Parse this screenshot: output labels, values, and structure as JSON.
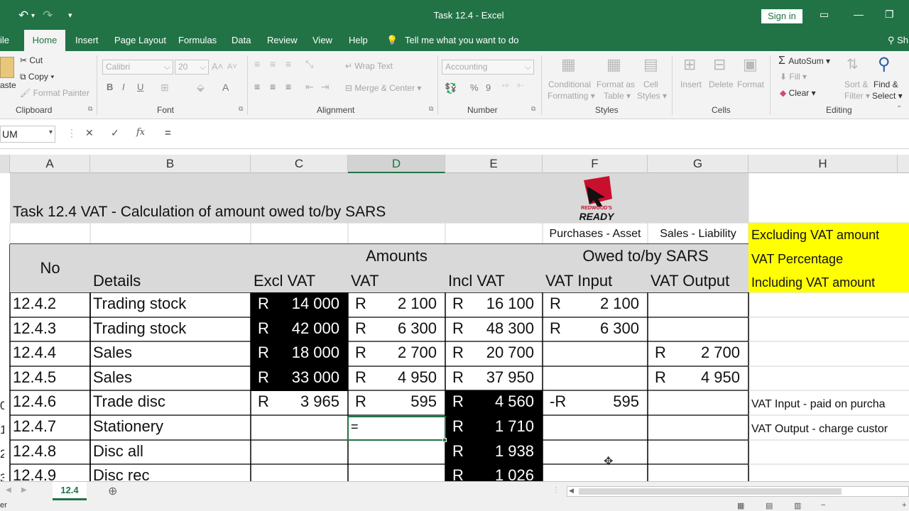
{
  "window": {
    "title": "Task 12.4 - Excel",
    "sign_in": "Sign in"
  },
  "tabs": [
    "ile",
    "Home",
    "Insert",
    "Page Layout",
    "Formulas",
    "Data",
    "Review",
    "View",
    "Help"
  ],
  "tell_me": "Tell me what you want to do",
  "share_partial": "Sh",
  "ribbon": {
    "clipboard": {
      "paste": "aste",
      "cut": "Cut",
      "copy": "Copy",
      "format_painter": "Format Painter",
      "group": "Clipboard"
    },
    "font": {
      "name": "Calibri",
      "size": "20",
      "bold": "B",
      "italic": "I",
      "underline": "U",
      "font_color": "A",
      "group": "Font"
    },
    "alignment": {
      "wrap_text": "Wrap Text",
      "merge": "Merge & Center",
      "group": "Alignment"
    },
    "number": {
      "format": "Accounting",
      "percent": "%",
      "comma": "9",
      "group": "Number"
    },
    "styles": {
      "conditional": "Conditional",
      "conditional2": "Formatting",
      "format_as": "Format as",
      "format_as2": "Table",
      "cell_styles": "Cell",
      "cell_styles2": "Styles",
      "group": "Styles"
    },
    "cells": {
      "insert": "Insert",
      "delete": "Delete",
      "format": "Format",
      "group": "Cells"
    },
    "editing": {
      "autosum": "AutoSum",
      "fill": "Fill",
      "clear": "Clear",
      "sort": "Sort &",
      "sort2": "Filter",
      "find": "Find &",
      "find2": "Select",
      "group": "Editing"
    }
  },
  "formula_bar": {
    "name_box": "UM",
    "cancel": "✕",
    "enter": "✓",
    "fx": "fx",
    "content": "="
  },
  "columns": [
    "A",
    "B",
    "C",
    "D",
    "E",
    "F",
    "G",
    "H"
  ],
  "logo": {
    "line1": "REDWOOD'S",
    "line2": "READY"
  },
  "sheet": {
    "title": "Task 12.4  VAT -  Calculation of amount owed to/by SARS",
    "purchases_label": "Purchases - Asset",
    "sales_label": "Sales - Liability",
    "no": "No",
    "details": "Details",
    "amounts": "Amounts",
    "owed": "Owed to/by SARS",
    "excl": "Excl VAT",
    "vat": "VAT",
    "incl": "Incl VAT",
    "vat_input": "VAT Input",
    "vat_output": "VAT Output",
    "legend": [
      "Excluding VAT amount",
      "VAT Percentage",
      "Including VAT amount"
    ],
    "rows": [
      {
        "no": "12.4.2",
        "details": "Trading stock",
        "c": "14 000",
        "d": "2 100",
        "e": "16 100",
        "f": "2 100",
        "g": ""
      },
      {
        "no": "12.4.3",
        "details": "Trading stock",
        "c": "42 000",
        "d": "6 300",
        "e": "48 300",
        "f": "6 300",
        "g": ""
      },
      {
        "no": "12.4.4",
        "details": "Sales",
        "c": "18 000",
        "d": "2 700",
        "e": "20 700",
        "f": "",
        "g": "2 700"
      },
      {
        "no": "12.4.5",
        "details": "Sales",
        "c": "33 000",
        "d": "4 950",
        "e": "37 950",
        "f": "",
        "g": "4 950"
      },
      {
        "no": "12.4.6",
        "details": "Trade disc",
        "c": "3 965",
        "d": "595",
        "e": "4 560",
        "f": "595",
        "g": ""
      },
      {
        "no": "12.4.7",
        "details": "Stationery",
        "c": "",
        "d": "=",
        "e": "1 710",
        "f": "",
        "g": ""
      },
      {
        "no": "12.4.8",
        "details": "Disc all",
        "c": "",
        "d": "",
        "e": "1 938",
        "f": "",
        "g": ""
      },
      {
        "no": "12.4.9",
        "details": "Disc rec",
        "c": "",
        "d": "",
        "e": "1 026",
        "f": "",
        "g": ""
      }
    ],
    "currency": "R",
    "neg_currency": "-R",
    "note1": "VAT Input - paid on purcha",
    "note2": "VAT Output - charge custor",
    "row_numbers": [
      "0",
      "1",
      "2",
      "3"
    ]
  },
  "sheet_tab": "12.4",
  "status_partial": "er"
}
